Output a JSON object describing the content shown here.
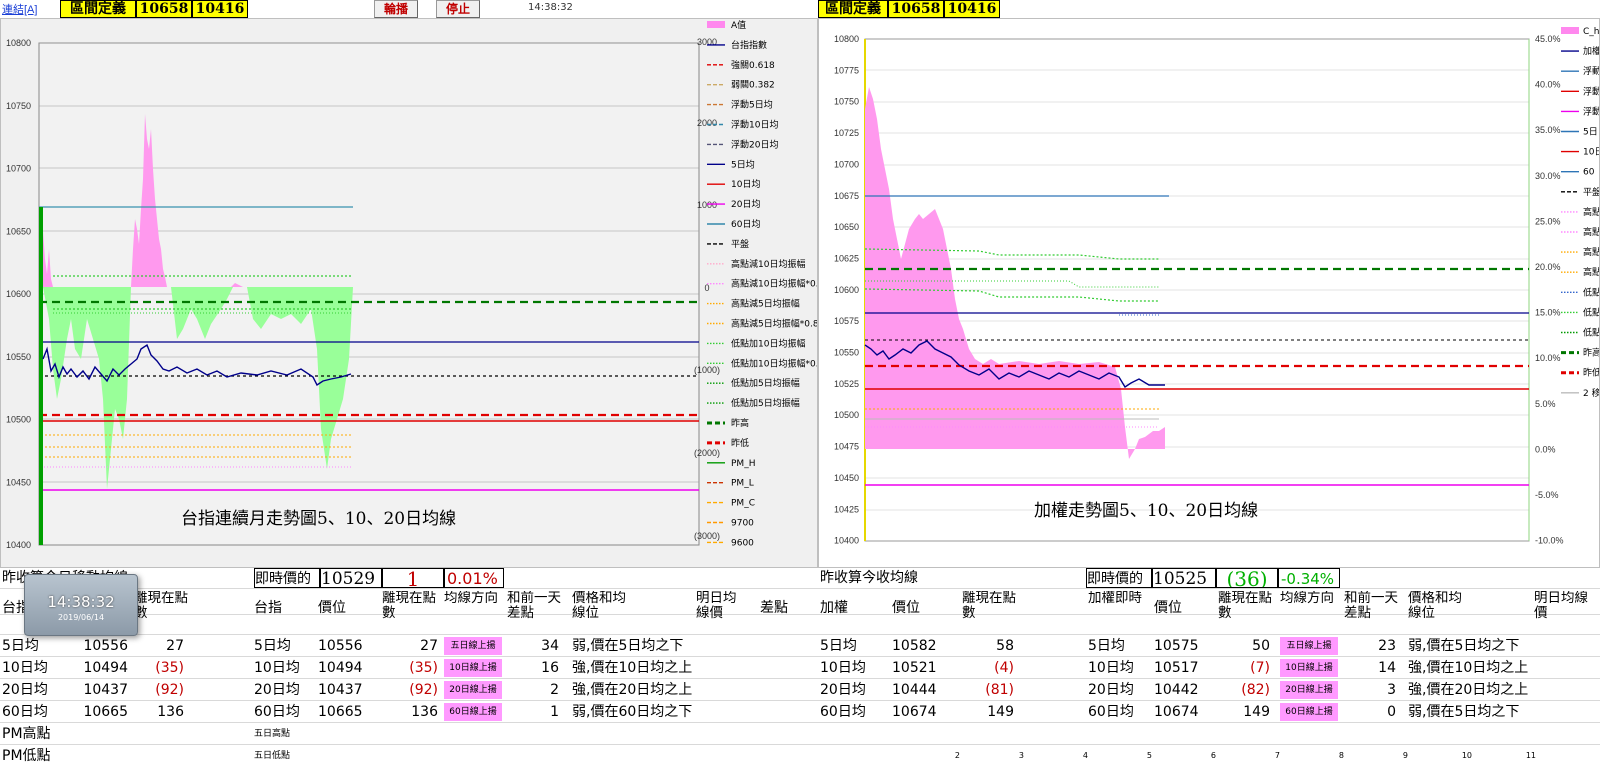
{
  "toolbar": {
    "link": "連結[A]",
    "range_label": "區間定義",
    "range_high": "10658",
    "range_low": "10416",
    "broadcast_button": "輪播",
    "stop_button": "停止",
    "time": "14:38:32",
    "right_range_label": "區間定義",
    "right_range_high": "10658",
    "right_range_low": "10416"
  },
  "left_chart": {
    "caption": "台指連續月走勢圖5、10、20日均線",
    "y_left_ticks": [
      "10800",
      "10750",
      "10700",
      "10650",
      "10600",
      "10550",
      "10500",
      "10450",
      "10400"
    ],
    "y_right_ticks": [
      "3000",
      "2000",
      "1000",
      "0",
      "(1000)",
      "(2000)",
      "(3000)"
    ],
    "legend": [
      "A值",
      "台指指數",
      "強關0.618",
      "弱關0.382",
      "浮動5日均",
      "浮動10日均",
      "浮動20日均",
      "5日均",
      "10日均",
      "20日均",
      "60日均",
      "平盤",
      "高點減10日均振幅",
      "高點減10日均振幅*0.8",
      "高點減5日均振幅",
      "高點減5日均振幅*0.8",
      "低點加10日均振幅",
      "低點加10日均振幅*0.8",
      "低點加5日均振幅",
      "低點加5日均振幅",
      "昨高",
      "昨低",
      "PM_H",
      "PM_L",
      "PM_C",
      "9700",
      "9600"
    ],
    "colors": {
      "pink": "#ff88ee",
      "green": "#88ff88",
      "navy": "#0a0a8a",
      "red": "#e00000",
      "magenta": "#ee00ee",
      "teal": "#3388aa",
      "darkgreen": "#008800",
      "orange": "#ffaa00"
    }
  },
  "right_chart": {
    "caption": "加權走勢圖5、10、20日均線",
    "y_left_ticks": [
      "10800",
      "10775",
      "10750",
      "10725",
      "10700",
      "10675",
      "10650",
      "10625",
      "10600",
      "10575",
      "10550",
      "10525",
      "10500",
      "10475",
      "10450",
      "10425",
      "10400"
    ],
    "y_right_ticks": [
      "45.0%",
      "40.0%",
      "35.0%",
      "30.0%",
      "25.0%",
      "20.0%",
      "15.0%",
      "10.0%",
      "5.0%",
      "0.0%",
      "-5.0%",
      "-10.0%"
    ],
    "legend": [
      "C_h",
      "加權",
      "浮動",
      "浮動",
      "浮動",
      "5日",
      "10日",
      "60",
      "平盤",
      "高點",
      "高點",
      "高點",
      "高點",
      "低點",
      "低點",
      "低點",
      "昨高",
      "昨低",
      "2 移"
    ]
  },
  "left_table": {
    "title": "昨收算今日移動均線",
    "realtime_label": "即時價的",
    "realtime_price": "10529",
    "realtime_diff": "1",
    "realtime_pct": "0.01%",
    "headers": [
      "台指",
      "價位",
      "離現在點數",
      "均線方向",
      "和前一天差點",
      "價格和均線位",
      "明日均線價",
      "差點"
    ],
    "clock_time": "14:38:32",
    "clock_date": "2019/06/14",
    "rows": [
      {
        "name": "5日均",
        "price": "10556",
        "dist": "27",
        "dist_neg": false,
        "dir": "五日線上揚",
        "diff": "34",
        "pos": "弱,價在5日均之下"
      },
      {
        "name": "10日均",
        "price": "10494",
        "dist": "(35)",
        "dist_neg": true,
        "dir": "10日線上揚",
        "diff": "16",
        "pos": "強,價在10日均之上"
      },
      {
        "name": "20日均",
        "price": "10437",
        "dist": "(92)",
        "dist_neg": true,
        "dir": "20日線上揚",
        "diff": "2",
        "pos": "強,價在20日均之上"
      },
      {
        "name": "60日均",
        "price": "10665",
        "dist": "136",
        "dist_neg": false,
        "dir": "60日線上揚",
        "diff": "1",
        "pos": "弱,價在60日均之下"
      }
    ],
    "pm_high": "PM高點",
    "pm_low": "PM低點",
    "five_high": "五日高點",
    "five_low": "五日低點"
  },
  "right_table": {
    "title": "昨收算今收均線",
    "realtime_label": "即時價的",
    "realtime_price": "10525",
    "realtime_diff": "(36)",
    "realtime_pct": "-0.34%",
    "headers_a": [
      "加權",
      "價位",
      "離現在點數"
    ],
    "headers_b": [
      "加權即時",
      "價位",
      "離現在點數",
      "均線方向",
      "和前一天差點",
      "價格和均線位",
      "明日均線價"
    ],
    "rows_a": [
      {
        "name": "5日均",
        "price": "10582",
        "dist": "58",
        "dist_neg": false
      },
      {
        "name": "10日均",
        "price": "10521",
        "dist": "(4)",
        "dist_neg": true
      },
      {
        "name": "20日均",
        "price": "10444",
        "dist": "(81)",
        "dist_neg": true
      },
      {
        "name": "60日均",
        "price": "10674",
        "dist": "149",
        "dist_neg": false
      }
    ],
    "rows_b": [
      {
        "name": "5日均",
        "price": "10575",
        "dist": "50",
        "dist_neg": false,
        "dir": "五日線上揚",
        "diff": "23",
        "pos": "弱,價在5日均之下"
      },
      {
        "name": "10日均",
        "price": "10517",
        "dist": "(7)",
        "dist_neg": true,
        "dir": "10日線上揚",
        "diff": "14",
        "pos": "強,價在10日均之上"
      },
      {
        "name": "20日均",
        "price": "10442",
        "dist": "(82)",
        "dist_neg": true,
        "dir": "20日線上揚",
        "diff": "3",
        "pos": "強,價在20日均之上"
      },
      {
        "name": "60日均",
        "price": "10674",
        "dist": "149",
        "dist_neg": false,
        "dir": "60日線上揚",
        "diff": "0",
        "pos": "弱,價在5日均之下"
      }
    ],
    "bottom_numbers": [
      "2",
      "3",
      "4",
      "5",
      "6",
      "7",
      "8",
      "9",
      "10",
      "11"
    ]
  }
}
